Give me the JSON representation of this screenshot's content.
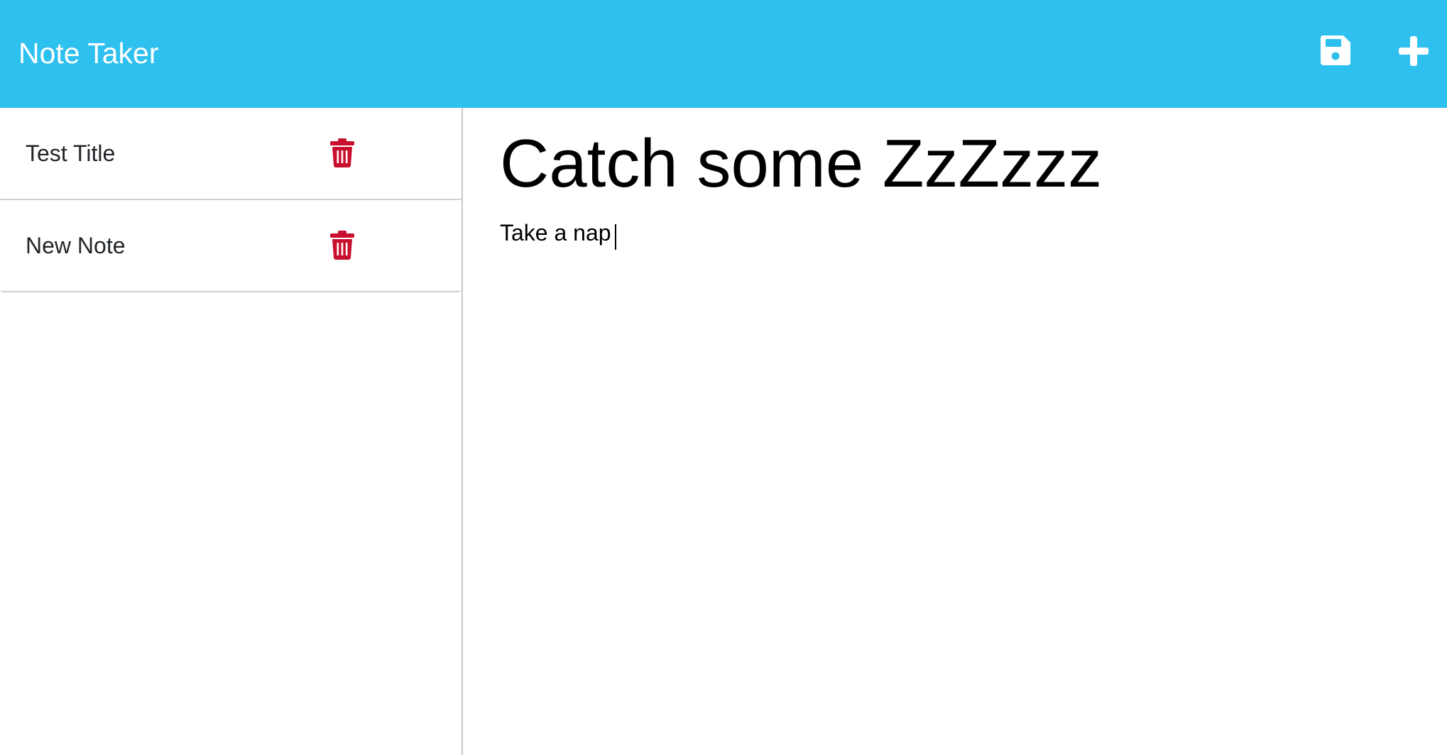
{
  "app": {
    "brand": "Note Taker"
  },
  "toolbar": {
    "save_icon": "save-icon",
    "new_icon": "plus-icon"
  },
  "notes": [
    {
      "title": "Test Title",
      "delete_icon": "trash-icon"
    },
    {
      "title": "New Note",
      "delete_icon": "trash-icon"
    }
  ],
  "editor": {
    "title": "Catch some ZzZzzz",
    "text": "Take a nap "
  },
  "colors": {
    "navbar": "#2ec0ee",
    "delete": "#c8102e",
    "text": "#212529"
  }
}
